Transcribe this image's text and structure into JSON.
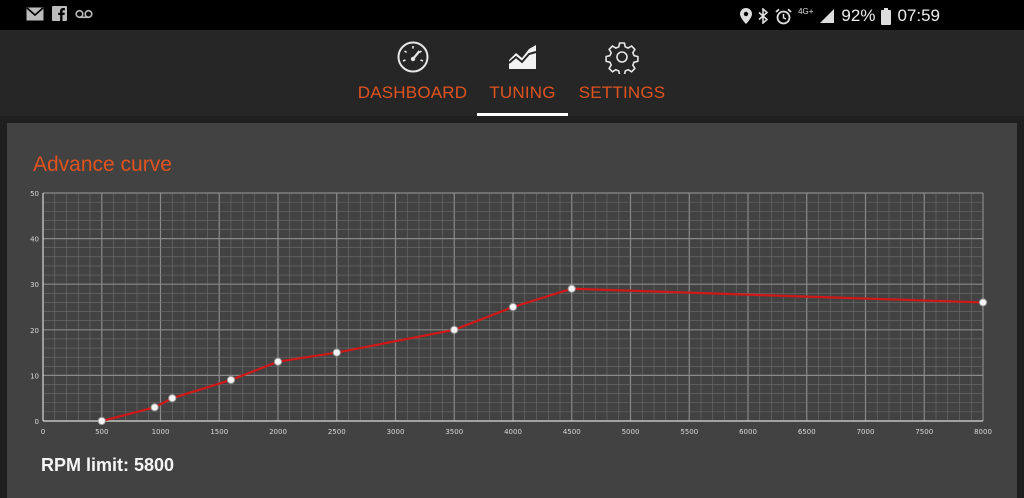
{
  "status_bar": {
    "left_icons": [
      "mail-icon",
      "facebook-icon",
      "voicemail-icon"
    ],
    "right_icons": [
      "location-icon",
      "bluetooth-icon",
      "alarm-icon",
      "network-4g-icon",
      "signal-icon"
    ],
    "network_label": "4G+",
    "battery": "92%",
    "time": "07:59"
  },
  "tabs": [
    {
      "label": "DASHBOARD",
      "icon": "speedometer-icon",
      "active": false
    },
    {
      "label": "TUNING",
      "icon": "chart-area-icon",
      "active": true
    },
    {
      "label": "SETTINGS",
      "icon": "gear-icon",
      "active": false
    }
  ],
  "card": {
    "title": "Advance curve",
    "rpm_label": "RPM limit:",
    "rpm_value": "5800"
  },
  "colors": {
    "accent": "#e0531f",
    "series": "#d01818",
    "card_bg": "#424242",
    "header_bg": "#262626"
  },
  "chart_data": {
    "type": "line",
    "x_ticks": [
      "0",
      "500",
      "1000",
      "1500",
      "2000",
      "2500",
      "3000",
      "3500",
      "4000",
      "4500",
      "5000",
      "5500",
      "6000",
      "6500",
      "7000",
      "7500",
      "8000"
    ],
    "y_ticks": [
      "0",
      "10",
      "20",
      "30",
      "40",
      "50"
    ],
    "xlim": [
      0,
      8000
    ],
    "ylim": [
      0,
      50
    ],
    "grid": true,
    "series": [
      {
        "x": [
          500,
          950,
          1100,
          1600,
          2000,
          2500,
          3500,
          4000,
          4500,
          8000
        ],
        "y": [
          0,
          3,
          5,
          9,
          13,
          15,
          20,
          25,
          29,
          26
        ]
      }
    ]
  }
}
